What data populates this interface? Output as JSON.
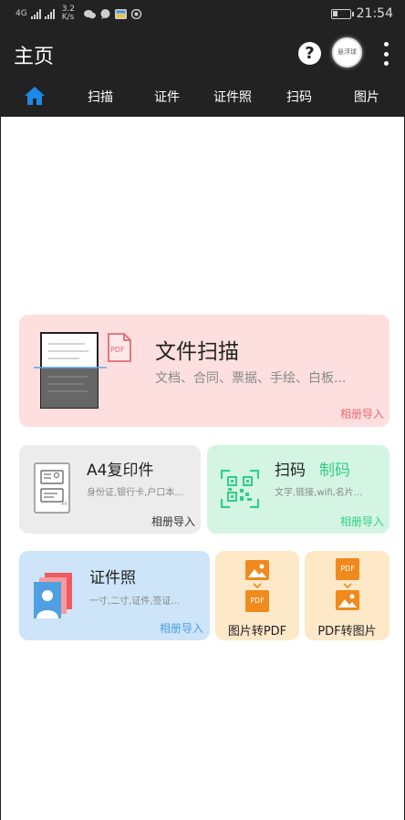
{
  "status_bar": {
    "network": "4G",
    "speed_value": "3.2",
    "speed_unit": "K/s",
    "time": "21:54"
  },
  "app_bar": {
    "title": "主页",
    "help_label": "?",
    "avatar_text": "悬浮球"
  },
  "tabs": [
    {
      "label": "扫描"
    },
    {
      "label": "证件"
    },
    {
      "label": "证件照"
    },
    {
      "label": "扫码"
    },
    {
      "label": "图片"
    }
  ],
  "cards": {
    "scan": {
      "title": "文件扫描",
      "subtitle": "文档、合同、票据、手绘、白板...",
      "import": "相册导入",
      "pdf_label": "PDF"
    },
    "a4": {
      "title": "A4复印件",
      "subtitle": "身份证,银行卡,户口本...",
      "import": "相册导入",
      "doc_tag": "A4"
    },
    "qr": {
      "title": "扫码",
      "title2": "制码",
      "subtitle": "文字,链接,wifi,名片...",
      "import": "相册导入"
    },
    "id_photo": {
      "title": "证件照",
      "subtitle": "一寸,二寸,证件,签证...",
      "import": "相册导入"
    },
    "img_to_pdf": {
      "label": "图片转PDF",
      "pdf_label": "PDF"
    },
    "pdf_to_img": {
      "label": "PDF转图片",
      "pdf_label": "PDF"
    }
  },
  "colors": {
    "bar_bg": "#222222",
    "home_icon": "#1e88e5",
    "scan_accent": "#e9686e",
    "qr_accent": "#2fcf86",
    "id_accent": "#4f9fe3",
    "orange": "#f08a1c"
  }
}
